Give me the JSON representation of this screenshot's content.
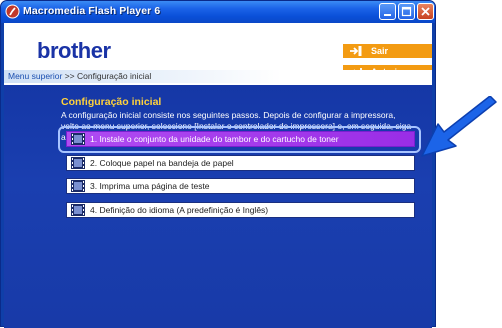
{
  "window": {
    "title": "Macromedia Flash Player 6",
    "controls": [
      "minimize",
      "maximize",
      "close"
    ]
  },
  "header": {
    "logo": "brother",
    "breadcrumb": {
      "link": "Menu superior",
      "separator": ">>",
      "current": "Configuração inicial"
    },
    "buttons": {
      "exit_label": "Sair",
      "back_label": "Anterior"
    }
  },
  "main": {
    "title": "Configuração inicial",
    "description": "A configuração inicial consiste nos seguintes passos. Depois de configurar a impressora, volte ao menu superior,  seleccione [Instalar o controlador de impressora] e, em seguida, siga as instruções apresentadas no ecrã, para instalar o controlador de impressora.",
    "steps": [
      {
        "label": "1. Instale o conjunto da unidade do tambor e do cartucho de toner",
        "active": true
      },
      {
        "label": "2. Coloque papel na bandeja de papel",
        "active": false
      },
      {
        "label": "3. Imprima uma página de teste",
        "active": false
      },
      {
        "label": "4. Definição do idioma (A predefinição é Inglês)",
        "active": false
      }
    ]
  },
  "colors": {
    "panel": "#1a3fb0",
    "accent_orange": "#f39b12",
    "active_step": "#a33be8",
    "title_yellow": "#ffd23c",
    "pointer_arrow": "#1c64e8"
  },
  "icons": {
    "app": "flash-player-icon",
    "step": "film-strip-icon",
    "exit": "exit-arrow-icon",
    "back": "return-arrow-icon",
    "annotation": "pointer-arrow"
  }
}
